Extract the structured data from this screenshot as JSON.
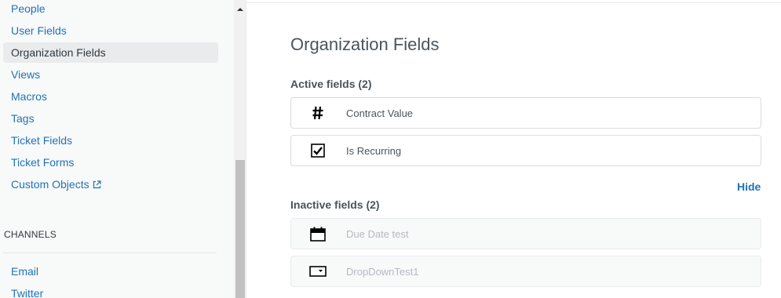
{
  "sidebar": {
    "items": [
      {
        "label": "People"
      },
      {
        "label": "User Fields"
      },
      {
        "label": "Organization Fields"
      },
      {
        "label": "Views"
      },
      {
        "label": "Macros"
      },
      {
        "label": "Tags"
      },
      {
        "label": "Ticket Fields"
      },
      {
        "label": "Ticket Forms"
      },
      {
        "label": "Custom Objects",
        "icon": "external-link-icon"
      }
    ],
    "active_item": "Organization Fields",
    "channels_header": "CHANNELS",
    "channels": [
      {
        "label": "Email"
      },
      {
        "label": "Twitter"
      }
    ]
  },
  "main": {
    "title": "Organization Fields",
    "active_label": "Active fields (2)",
    "active_fields": [
      {
        "label": "Contract Value",
        "icon": "hash-icon"
      },
      {
        "label": "Is Recurring",
        "icon": "checkbox-icon"
      }
    ],
    "hide_label": "Hide",
    "inactive_label": "Inactive fields (2)",
    "inactive_fields": [
      {
        "label": "Due Date test",
        "icon": "calendar-icon"
      },
      {
        "label": "DropDownTest1",
        "icon": "dropdown-icon"
      }
    ]
  },
  "colors": {
    "link": "#1f73b7",
    "active_bg": "#e9ebed",
    "text": "#49545c",
    "muted": "#b3bac1"
  }
}
